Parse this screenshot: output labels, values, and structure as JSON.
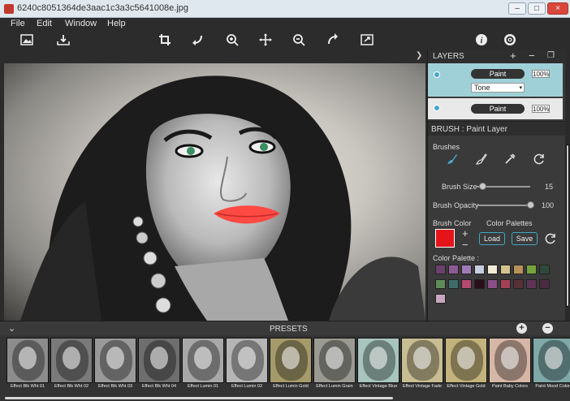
{
  "window": {
    "title": "6240c8051364de3aac1c3a3c5641008e.jpg",
    "btn_min": "–",
    "btn_max": "□",
    "btn_close": "×"
  },
  "menu": [
    "File",
    "Edit",
    "Window",
    "Help"
  ],
  "toolbar": {
    "icons": [
      "open-image-icon",
      "save-image-icon",
      "crop-icon",
      "rotate-left-icon",
      "zoom-in-icon",
      "move-icon",
      "zoom-out-icon",
      "rotate-right-icon",
      "fit-screen-icon",
      "info-icon",
      "settings-icon"
    ]
  },
  "layers": {
    "title": "LAYERS",
    "add": "+",
    "remove": "−",
    "items": [
      {
        "name": "Paint",
        "opacity": "100%",
        "blend": "Tone"
      },
      {
        "name": "Paint",
        "opacity": "100%"
      }
    ]
  },
  "brush": {
    "title": "BRUSH : Paint Layer",
    "brushes_label": "Brushes",
    "size_label": "Brush Size",
    "size_value": "15",
    "size_fraction": 0.1,
    "opacity_label": "Brush Opacity",
    "opacity_value": "100",
    "opacity_fraction": 1.0,
    "color_label": "Brush Color",
    "color": "#e4141a",
    "palettes_label": "Color Palettes",
    "load": "Load",
    "save": "Save",
    "palette_label": "Color Palette :",
    "add": "+",
    "remove": "−",
    "palette": [
      "#6b3f6e",
      "#8c5a95",
      "#a07ab8",
      "#c7cde0",
      "#f1ecd5",
      "#d4c28f",
      "#b69158",
      "#78a33c",
      "#2f4a3a",
      "#5f8b5a",
      "#3f6c6a",
      "#b44a6f",
      "#2a0f1b",
      "#8a4f86",
      "#a43f58",
      "#5a3038",
      "#5d3455",
      "#4b2b42",
      "#c9a6c0"
    ]
  },
  "presets": {
    "title": "PRESETS",
    "collapse": "⌄",
    "items": [
      {
        "label": "Effect Blk Wht 01",
        "tint": "#8c8c8c"
      },
      {
        "label": "Effect Blk Wht 02",
        "tint": "#7a7a7a"
      },
      {
        "label": "Effect Blk Wht 03",
        "tint": "#999999"
      },
      {
        "label": "Effect Blk Wht 04",
        "tint": "#6e6e6e"
      },
      {
        "label": "Effect Lumin 01",
        "tint": "#a8a8a8"
      },
      {
        "label": "Effect Lumin 02",
        "tint": "#b5b5b5"
      },
      {
        "label": "Effect Lumin Gold",
        "tint": "#a59a6a"
      },
      {
        "label": "Effect Lumin Grain",
        "tint": "#9a9a92"
      },
      {
        "label": "Effect Vintage Blue",
        "tint": "#a7c5bd"
      },
      {
        "label": "Effect Vintage Fade",
        "tint": "#c8bd92"
      },
      {
        "label": "Effect Vintage Gold",
        "tint": "#c2b37c"
      },
      {
        "label": "Paint Baby Colors",
        "tint": "#d6b6a6"
      },
      {
        "label": "Paint Mood Colors",
        "tint": "#7fa8a8"
      }
    ]
  }
}
